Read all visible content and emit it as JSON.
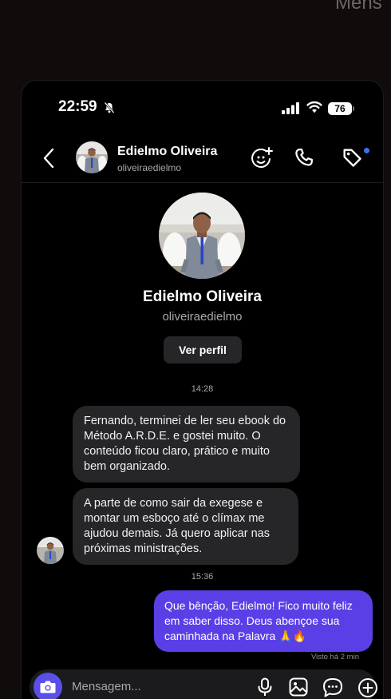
{
  "background_text": "Mens",
  "status_bar": {
    "time": "22:59",
    "battery": "76"
  },
  "header": {
    "name": "Edielmo Oliveira",
    "username": "oliveiraedielmo"
  },
  "profile": {
    "name": "Edielmo Oliveira",
    "username": "oliveiraedielmo",
    "view_profile": "Ver perfil"
  },
  "messages": {
    "time1": "14:28",
    "incoming": [
      "Fernando, terminei de ler seu ebook do Método A.R.D.E. e gostei muito. O conteúdo ficou claro, prático e muito bem organizado.",
      "A parte de como sair da exegese e montar um esboço até o clímax me ajudou demais. Já quero aplicar nas próximas ministrações."
    ],
    "time2": "15:36",
    "outgoing": "Que bênção, Edielmo! Fico muito feliz em saber disso. Deus abençoe sua caminhada na Palavra 🙏🔥",
    "seen": "Visto há 2 min"
  },
  "composer": {
    "placeholder": "Mensagem..."
  },
  "colors": {
    "accent": "#5b3fe6",
    "incoming_bubble": "#262629",
    "notification_dot": "#3d6ff6"
  }
}
